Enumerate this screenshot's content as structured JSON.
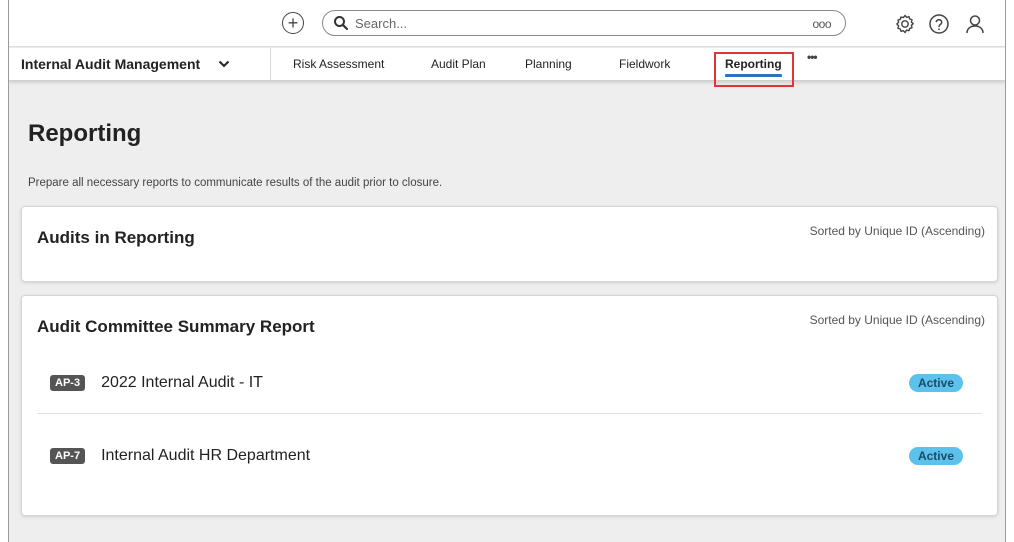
{
  "topbar": {
    "search_placeholder": "Search...",
    "search_more": "ooo"
  },
  "navbar": {
    "app_name": "Internal Audit Management",
    "items": [
      {
        "label": "Risk Assessment"
      },
      {
        "label": "Audit Plan"
      },
      {
        "label": "Planning"
      },
      {
        "label": "Fieldwork"
      },
      {
        "label": "Reporting"
      }
    ],
    "more": "•••"
  },
  "page": {
    "title": "Reporting",
    "description": "Prepare all necessary reports to communicate results of the audit prior to closure."
  },
  "cards": [
    {
      "title": "Audits in Reporting",
      "sort_text": "Sorted by Unique ID (Ascending)",
      "rows": []
    },
    {
      "title": "Audit Committee Summary Report",
      "sort_text": "Sorted by Unique ID (Ascending)",
      "rows": [
        {
          "id": "AP-3",
          "label": "2022 Internal Audit - IT",
          "status": "Active"
        },
        {
          "id": "AP-7",
          "label": "Internal Audit HR Department",
          "status": "Active"
        }
      ]
    }
  ],
  "colors": {
    "accent": "#2f6fc4",
    "highlight": "#e0343a",
    "status_active": "#5cc2ec"
  }
}
